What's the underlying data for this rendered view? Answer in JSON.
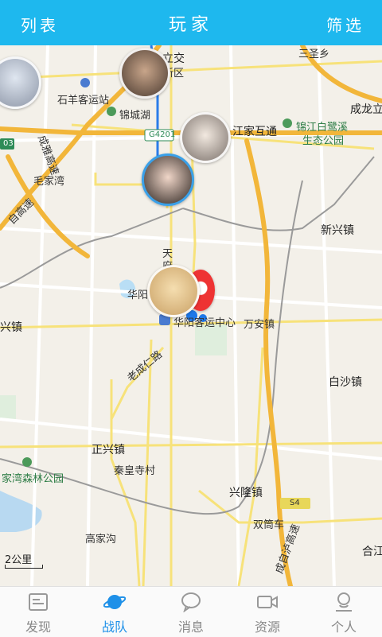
{
  "header": {
    "left_label": "列表",
    "title": "玩家",
    "right_label": "筛选"
  },
  "map": {
    "labels": {
      "lijiao": "立交",
      "xinqu": "新区",
      "sanshengxiang": "三圣乡",
      "shiyang_keyunzhan": "石羊客运站",
      "jinchenghu": "锦城湖",
      "chenglonglu": "成龙立",
      "g4201": "G4201",
      "jiangjia_hutong": "江家互通",
      "jinjiang_bailuxi": "锦江白鹭溪",
      "shengtai_gongyuan": "生态公园",
      "chengya_gaosu": "成雅高速",
      "maojiawan": "毛家湾",
      "chengzi_gaosu": "自高速",
      "xinxingzhen": "新兴镇",
      "tianfu": "天府",
      "huayang": "华阳",
      "huayang_keyunzhongxin": "华阳客运中心",
      "wananzhen": "万安镇",
      "xingzhen_left": "兴镇",
      "laochengren_lu": "老成仁路",
      "baishazhen": "白沙镇",
      "zhengxingzhen": "正兴镇",
      "qinhuangsi_cun": "秦皇寺村",
      "senlin_gongyuan": "家湾森林公园",
      "xinglongzhen": "兴隆镇",
      "s4": "S4",
      "shuangtongche": "双筒车",
      "gaojiagou": "高家沟",
      "chengzi_lugao": "成自泸高速",
      "hejiang": "合江",
      "shield_03": "03"
    },
    "scale_label": "2公里"
  },
  "tabs": [
    {
      "label": "发现",
      "icon": "discover-icon",
      "active": false
    },
    {
      "label": "战队",
      "icon": "team-planet-icon",
      "active": true
    },
    {
      "label": "消息",
      "icon": "message-icon",
      "active": false
    },
    {
      "label": "资源",
      "icon": "video-icon",
      "active": false
    },
    {
      "label": "个人",
      "icon": "person-icon",
      "active": false
    }
  ],
  "colors": {
    "header_bg": "#1eb8ee",
    "active_tab": "#1e90e8",
    "highway": "#f2b63a",
    "road": "#f7e27a"
  }
}
